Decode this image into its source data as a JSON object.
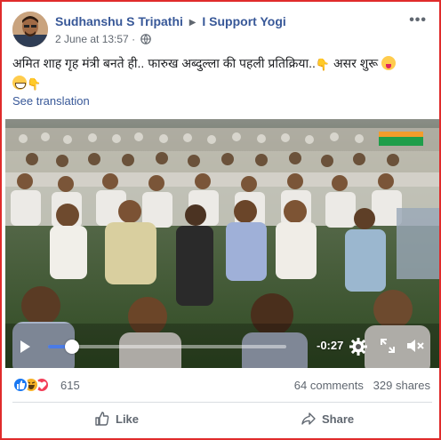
{
  "post": {
    "author": "Sudhanshu S Tripathi",
    "group": "I Support Yogi",
    "timestamp": "2 June at 13:57",
    "privacy_icon": "globe-icon",
    "more_icon": "ellipsis-icon",
    "text": "अमित शाह गृह मंत्री बनते ही.. फारुख अब्दुल्ला की पहली प्रतिक्रिया..",
    "text_tail": "असर शुरू",
    "see_translation": "See translation"
  },
  "video": {
    "current_time": "-0:27",
    "progress": 0.1,
    "play_icon": "play-icon",
    "settings_icon": "gear-icon",
    "fullscreen_icon": "fullscreen-icon",
    "volume_icon": "volume-muted-icon",
    "accent_color": "#4b7be5"
  },
  "engagement": {
    "reaction_icons": [
      "like-reaction-icon",
      "haha-reaction-icon",
      "love-reaction-icon"
    ],
    "reaction_count": "615",
    "comments": "64 comments",
    "shares": "329 shares"
  },
  "actions": {
    "like": "Like",
    "share": "Share"
  },
  "colors": {
    "link": "#385898",
    "meta": "#606770",
    "frame_border": "#e02b2b"
  }
}
